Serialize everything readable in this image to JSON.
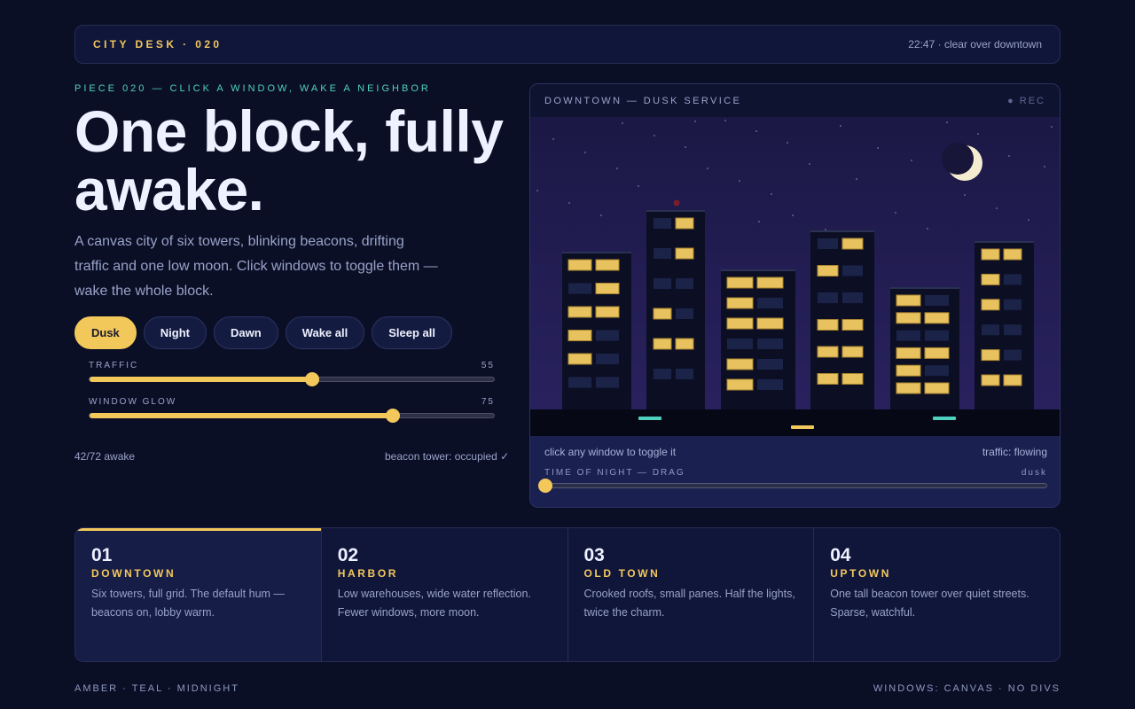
{
  "topbar": {
    "brand": "CITY DESK · 020",
    "status": "22:47 · clear over downtown"
  },
  "hero": {
    "kicker": "PIECE 020 — CLICK A WINDOW, WAKE A NEIGHBOR",
    "headline": "One block, fully awake.",
    "lede": "A canvas city of six towers, blinking beacons, drifting traffic and one low moon. Click windows to toggle them — wake the whole block."
  },
  "controls": {
    "buttons": [
      {
        "label": "Dusk",
        "active": true
      },
      {
        "label": "Night",
        "active": false
      },
      {
        "label": "Dawn",
        "active": false
      },
      {
        "label": "Wake all",
        "active": false
      },
      {
        "label": "Sleep all",
        "active": false
      }
    ],
    "sliders": [
      {
        "label": "TRAFFIC",
        "value": 55,
        "max": 100
      },
      {
        "label": "WINDOW GLOW",
        "value": 75,
        "max": 100
      }
    ]
  },
  "stats": {
    "awake": "42/72 awake",
    "beacon": "beacon tower: occupied ✓"
  },
  "panel": {
    "title": "DOWNTOWN — DUSK SERVICE",
    "rec": "● REC",
    "hint": "click any window to toggle it",
    "traffic": "traffic: flowing",
    "night_label": "TIME OF NIGHT — DRAG",
    "night_value": "dusk",
    "night_position": 0
  },
  "colors": {
    "accent": "#f3c85b",
    "teal": "#4fd1bf",
    "background": "#0b0f26",
    "window_on": "#e9c260",
    "window_off": "#1b2348"
  },
  "districts": [
    {
      "num": "01",
      "name": "DOWNTOWN",
      "desc": "Six towers, full grid. The default hum — beacons on, lobby warm.",
      "active": true
    },
    {
      "num": "02",
      "name": "HARBOR",
      "desc": "Low warehouses, wide water reflection. Fewer windows, more moon.",
      "active": false
    },
    {
      "num": "03",
      "name": "OLD TOWN",
      "desc": "Crooked roofs, small panes. Half the lights, twice the charm.",
      "active": false
    },
    {
      "num": "04",
      "name": "UPTOWN",
      "desc": "One tall beacon tower over quiet streets. Sparse, watchful.",
      "active": false
    }
  ],
  "footer": {
    "left": "AMBER · TEAL · MIDNIGHT",
    "right": "WINDOWS: CANVAS · NO DIVS"
  },
  "scene": {
    "towers": [
      {
        "name": "tower-1",
        "cols": 2,
        "rows": [
          [
            1,
            1
          ],
          [
            0,
            1
          ],
          [
            1,
            1
          ],
          [
            1,
            0
          ],
          [
            1,
            0
          ],
          [
            0,
            0
          ]
        ]
      },
      {
        "name": "tower-2",
        "cols": 2,
        "rows": [
          [
            0,
            1
          ],
          [
            0,
            1
          ],
          [
            0,
            0
          ],
          [
            1,
            0
          ],
          [
            1,
            1
          ],
          [
            0,
            0
          ]
        ]
      },
      {
        "name": "tower-3",
        "cols": 2,
        "rows": [
          [
            1,
            1
          ],
          [
            1,
            0
          ],
          [
            1,
            1
          ],
          [
            0,
            0
          ],
          [
            1,
            0
          ],
          [
            1,
            0
          ]
        ]
      },
      {
        "name": "tower-4",
        "cols": 2,
        "rows": [
          [
            0,
            1
          ],
          [
            1,
            0
          ],
          [
            0,
            0
          ],
          [
            1,
            1
          ],
          [
            1,
            1
          ],
          [
            1,
            1
          ]
        ]
      },
      {
        "name": "tower-5",
        "cols": 2,
        "rows": [
          [
            1,
            0
          ],
          [
            1,
            1
          ],
          [
            0,
            0
          ],
          [
            1,
            1
          ],
          [
            1,
            0
          ],
          [
            1,
            1
          ]
        ]
      },
      {
        "name": "tower-6",
        "cols": 2,
        "rows": [
          [
            1,
            1
          ],
          [
            1,
            0
          ],
          [
            1,
            0
          ],
          [
            0,
            0
          ],
          [
            1,
            0
          ],
          [
            1,
            1
          ]
        ]
      }
    ]
  }
}
